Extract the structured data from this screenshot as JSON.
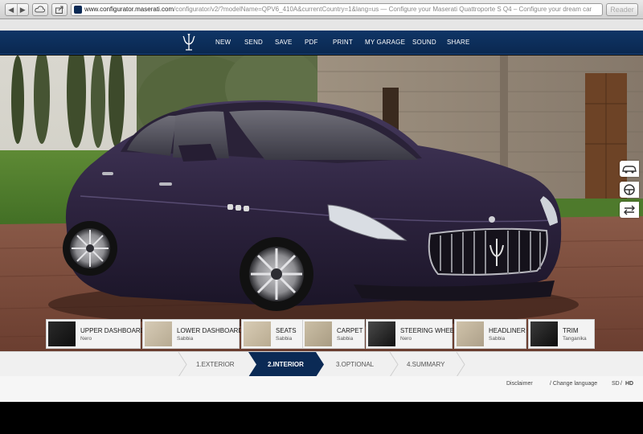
{
  "browser": {
    "back_glyph": "◀",
    "forward_glyph": "▶",
    "url_domain": "www.configurator.maserati.com",
    "url_rest": "/configurator/v2/?modelName=QPV6_410A&currentCountry=1&lang=us — Configure your Maserati Quattroporte S Q4 – Configure your dream car",
    "reader_label": "Reader",
    "icons": [
      "back-icon",
      "forward-icon",
      "icloud-icon",
      "share-icon",
      "favicon-icon"
    ]
  },
  "nav": {
    "items": [
      "NEW",
      "SEND",
      "SAVE",
      "PDF",
      "PRINT",
      "MY GARAGE",
      "SOUND",
      "SHARE"
    ]
  },
  "scene": {
    "car_color": "#2e2440",
    "tools": [
      "car-view-icon",
      "steering-wheel-icon",
      "swap-arrows-icon"
    ]
  },
  "swatches": [
    {
      "name": "UPPER DASHBOARD",
      "value": "Nero",
      "color": "#1a1a1a"
    },
    {
      "name": "LOWER DASHBOARD",
      "value": "Sabbia",
      "color": "#c9bca5"
    },
    {
      "name": "SEATS",
      "value": "Sabbia",
      "color": "#cbbfa8"
    },
    {
      "name": "CARPET",
      "value": "Sabbia",
      "color": "#bfb299"
    },
    {
      "name": "STEERING WHEEL",
      "value": "Nero",
      "color": "#2a2a2a"
    },
    {
      "name": "HEADLINER",
      "value": "Sabbia",
      "color": "#c4b79f"
    },
    {
      "name": "TRIM",
      "value": "Tanganika",
      "color": "#1f1f1f"
    }
  ],
  "steps": [
    {
      "label": "1.EXTERIOR",
      "active": false
    },
    {
      "label": "2.INTERIOR",
      "active": true
    },
    {
      "label": "3.OPTIONAL",
      "active": false
    },
    {
      "label": "4.SUMMARY",
      "active": false
    }
  ],
  "footer": {
    "disclaimer": "Disclaimer",
    "change_language": "/ Change language",
    "sd": "SD",
    "separator": "/",
    "hd": "HD"
  },
  "colors": {
    "nav_blue": "#0a2850",
    "active_step": "#0b2a55"
  }
}
